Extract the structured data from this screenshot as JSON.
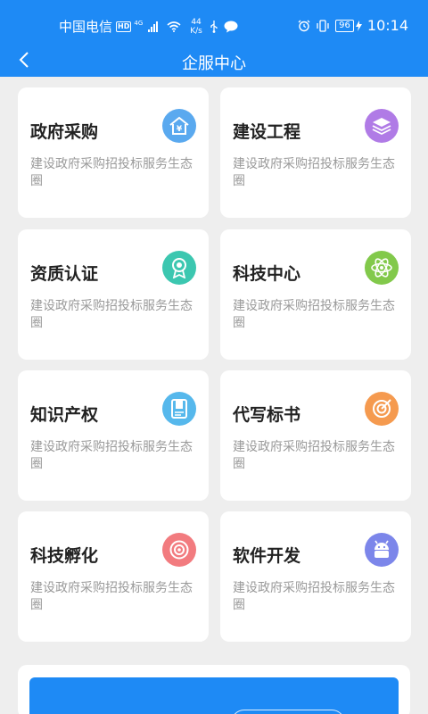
{
  "status_bar": {
    "carrier": "中国电信",
    "hd_badge": "HD",
    "network": "4G",
    "speed_value": "44",
    "speed_unit": "K/s",
    "battery": "96",
    "time": "10:14"
  },
  "nav": {
    "title": "企服中心"
  },
  "colors": {
    "brand": "#1e8af5"
  },
  "services": [
    {
      "title": "政府采购",
      "desc": "建设政府采购招投标服务生态圈",
      "icon": "yuan-house-icon",
      "color": "#5aa9ef"
    },
    {
      "title": "建设工程",
      "desc": "建设政府采购招投标服务生态圈",
      "icon": "layers-icon",
      "color": "#b07be6"
    },
    {
      "title": "资质认证",
      "desc": "建设政府采购招投标服务生态圈",
      "icon": "award-icon",
      "color": "#3cc7b0"
    },
    {
      "title": "科技中心",
      "desc": "建设政府采购招投标服务生态圈",
      "icon": "atom-icon",
      "color": "#82c94b"
    },
    {
      "title": "知识产权",
      "desc": "建设政府采购招投标服务生态圈",
      "icon": "document-icon",
      "color": "#56b8ec"
    },
    {
      "title": "代写标书",
      "desc": "建设政府采购招投标服务生态圈",
      "icon": "target-icon",
      "color": "#f59a4f"
    },
    {
      "title": "科技孵化",
      "desc": "建设政府采购招投标服务生态圈",
      "icon": "incubation-icon",
      "color": "#f27b7f"
    },
    {
      "title": "软件开发",
      "desc": "建设政府采购招投标服务生态圈",
      "icon": "android-icon",
      "color": "#7c86ea"
    }
  ]
}
